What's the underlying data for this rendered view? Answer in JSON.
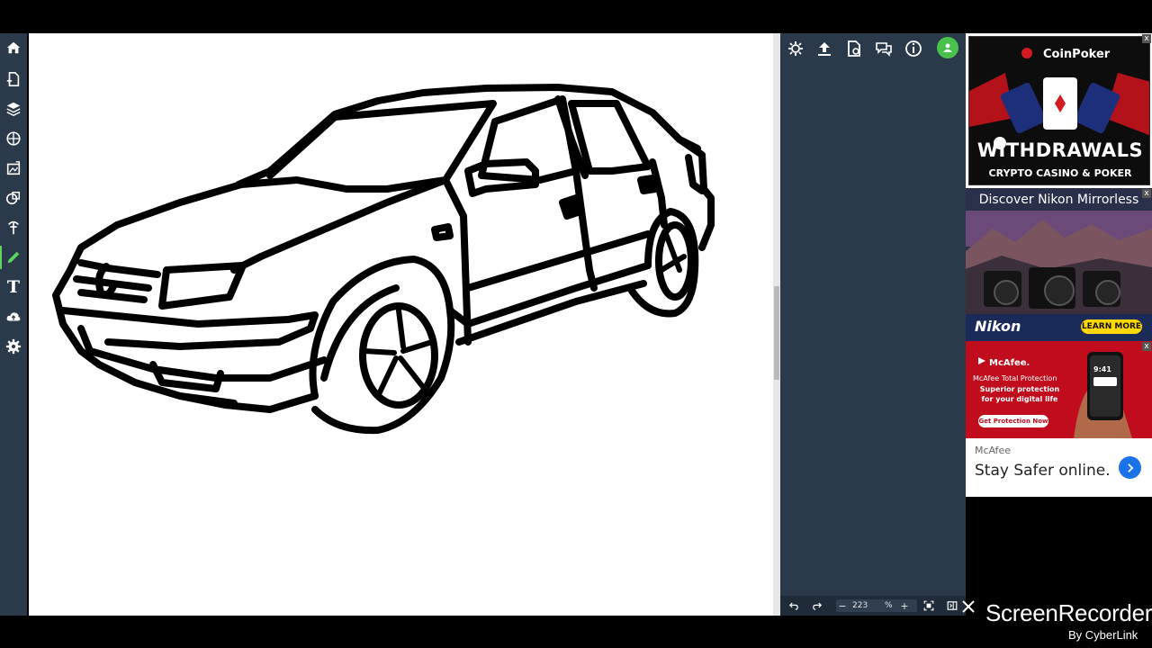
{
  "app": {
    "left_toolbar": [
      {
        "name": "home-icon",
        "active": false
      },
      {
        "name": "new-page-icon",
        "active": false
      },
      {
        "name": "layers-icon",
        "active": false
      },
      {
        "name": "filters-icon",
        "active": false
      },
      {
        "name": "image-adjust-icon",
        "active": false
      },
      {
        "name": "shapes-icon",
        "active": false
      },
      {
        "name": "brush-select-icon",
        "active": false
      },
      {
        "name": "pencil-icon",
        "active": true
      },
      {
        "name": "text-icon",
        "active": false
      },
      {
        "name": "cloud-upload-icon",
        "active": false
      },
      {
        "name": "settings-icon",
        "active": false
      }
    ],
    "panel_icons": [
      "settings-spark-icon",
      "upload-icon",
      "save-icon",
      "chat-icon",
      "info-icon",
      "user-avatar-icon"
    ],
    "text_tool_label": "T",
    "bottom_bar": {
      "undo": "undo-icon",
      "redo": "redo-icon",
      "zoom_minus": "−",
      "zoom_value": "223",
      "zoom_unit": "%",
      "zoom_plus": "+",
      "fit": "fit-screen-icon",
      "toggle": "panel-toggle-icon"
    },
    "colors": {
      "panel_bg": "#2b3a4a",
      "accent_green": "#48c24d",
      "canvas_bg": "#ffffff"
    }
  },
  "ads": {
    "coinpoker": {
      "brand": "CoinPoker",
      "headline": "WITHDRAWALS",
      "sub": "CRYPTO CASINO & POKER"
    },
    "nikon": {
      "title": "Discover Nikon Mirrorless",
      "logo": "Nikon",
      "cta": "LEARN MORE"
    },
    "mcafee_banner": {
      "brand": "McAfee.",
      "line1": "McAfee Total Protection",
      "line2": "Superior protection for your digital life",
      "cta": "Get Protection Now",
      "phone_time": "9:41"
    },
    "mcafee_text": {
      "brand": "McAfee",
      "text": "Stay Safer online."
    },
    "close_label": "x"
  },
  "watermark": {
    "title": "ScreenRecorder",
    "sub": "By CyberLink",
    "close": "✕"
  }
}
